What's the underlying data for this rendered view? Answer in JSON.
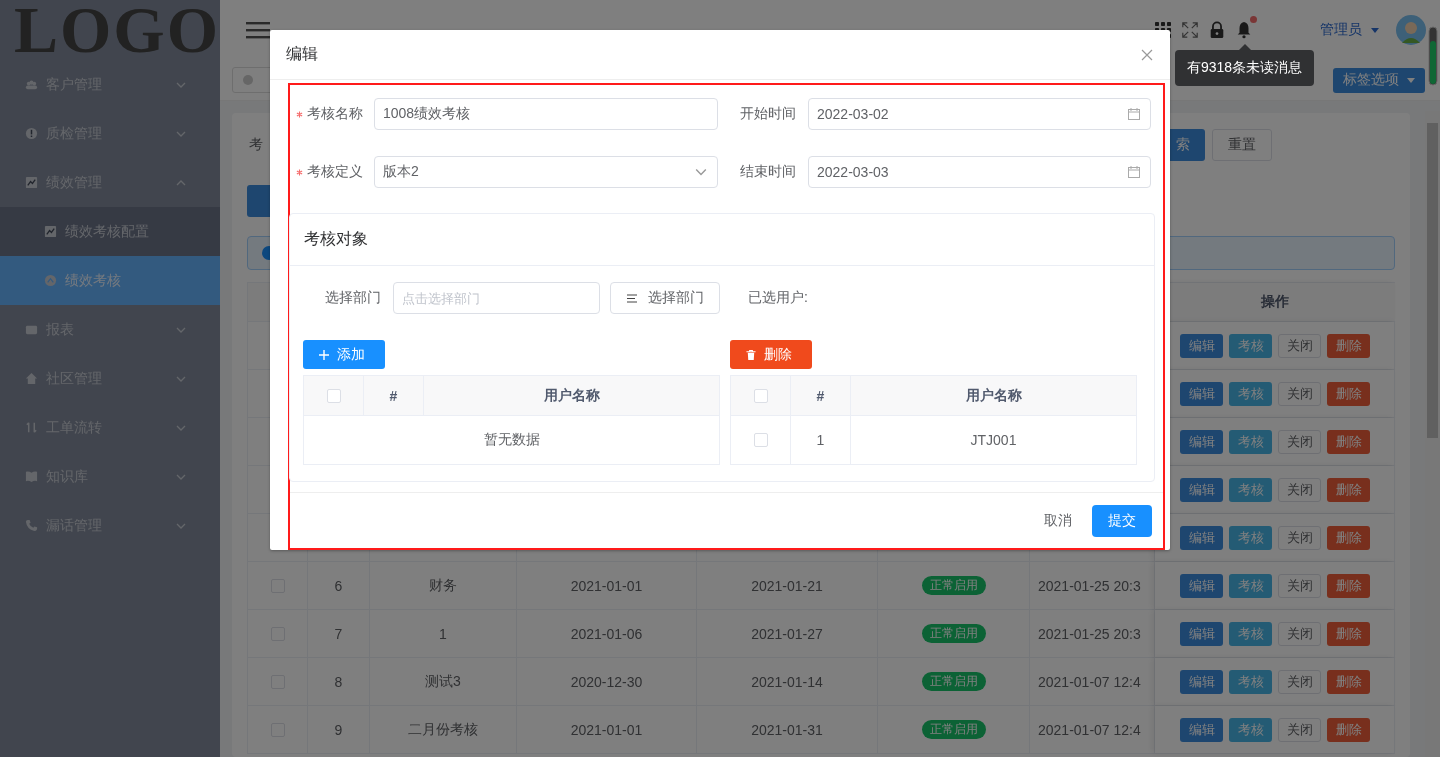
{
  "sidebar": {
    "logo": "LOGO",
    "items": [
      {
        "label": "客户管理",
        "selected": false,
        "expanded": false
      },
      {
        "label": "质检管理",
        "selected": false,
        "expanded": false
      },
      {
        "label": "绩效管理",
        "selected": false,
        "expanded": true,
        "children": [
          {
            "label": "绩效考核配置",
            "selected": false
          },
          {
            "label": "绩效考核",
            "selected": true
          }
        ]
      },
      {
        "label": "报表",
        "selected": false,
        "expanded": false
      },
      {
        "label": "社区管理",
        "selected": false,
        "expanded": false
      },
      {
        "label": "工单流转",
        "selected": false,
        "expanded": false
      },
      {
        "label": "知识库",
        "selected": false,
        "expanded": false
      },
      {
        "label": "漏话管理",
        "selected": false,
        "expanded": false
      }
    ]
  },
  "header": {
    "user": "管理员",
    "unread": true,
    "tooltip": "有9318条未读消息"
  },
  "tags_bar": {
    "options_button": "标签选项"
  },
  "search": {
    "label": "考",
    "search_button": "索",
    "reset_button": "重置"
  },
  "table": {
    "columns": [
      "操作"
    ],
    "rows": [
      {
        "actions": [
          {
            "label": "编辑",
            "kind": "primary"
          },
          {
            "label": "考核",
            "kind": "info"
          },
          {
            "label": "关闭",
            "kind": "plain"
          },
          {
            "label": "删除",
            "kind": "danger"
          }
        ]
      },
      {
        "actions": [
          {
            "label": "编辑",
            "kind": "primary"
          },
          {
            "label": "考核",
            "kind": "info"
          },
          {
            "label": "关闭",
            "kind": "plain"
          },
          {
            "label": "删除",
            "kind": "danger"
          }
        ]
      },
      {
        "actions": [
          {
            "label": "编辑",
            "kind": "primary"
          },
          {
            "label": "考核",
            "kind": "info"
          },
          {
            "label": "关闭",
            "kind": "plain"
          },
          {
            "label": "删除",
            "kind": "danger"
          }
        ]
      },
      {
        "actions": [
          {
            "label": "编辑",
            "kind": "primary"
          },
          {
            "label": "考核",
            "kind": "info"
          },
          {
            "label": "关闭",
            "kind": "plain"
          },
          {
            "label": "删除",
            "kind": "danger"
          }
        ]
      },
      {
        "actions": [
          {
            "label": "编辑",
            "kind": "primary"
          },
          {
            "label": "考核",
            "kind": "info"
          },
          {
            "label": "关闭",
            "kind": "plain"
          },
          {
            "label": "删除",
            "kind": "danger"
          }
        ]
      },
      {
        "checked": false,
        "index": "6",
        "name": "财务",
        "start": "2021-01-01",
        "end": "2021-01-21",
        "status": "正常启用",
        "created": "2021-01-25 20:3",
        "actions": [
          {
            "label": "编辑",
            "kind": "primary"
          },
          {
            "label": "考核",
            "kind": "info"
          },
          {
            "label": "关闭",
            "kind": "plain"
          },
          {
            "label": "删除",
            "kind": "danger"
          }
        ]
      },
      {
        "checked": false,
        "index": "7",
        "name": "1",
        "start": "2021-01-06",
        "end": "2021-01-27",
        "status": "正常启用",
        "created": "2021-01-25 20:3",
        "actions": [
          {
            "label": "编辑",
            "kind": "primary"
          },
          {
            "label": "考核",
            "kind": "info"
          },
          {
            "label": "关闭",
            "kind": "plain"
          },
          {
            "label": "删除",
            "kind": "danger"
          }
        ]
      },
      {
        "checked": false,
        "index": "8",
        "name": "测试3",
        "start": "2020-12-30",
        "end": "2021-01-14",
        "status": "正常启用",
        "created": "2021-01-07 12:4",
        "actions": [
          {
            "label": "编辑",
            "kind": "primary"
          },
          {
            "label": "考核",
            "kind": "info"
          },
          {
            "label": "关闭",
            "kind": "plain"
          },
          {
            "label": "删除",
            "kind": "danger"
          }
        ]
      },
      {
        "checked": false,
        "index": "9",
        "name": "二月份考核",
        "start": "2021-01-01",
        "end": "2021-01-31",
        "status": "正常启用",
        "created": "2021-01-07 12:4",
        "actions": [
          {
            "label": "编辑",
            "kind": "primary"
          },
          {
            "label": "考核",
            "kind": "info"
          },
          {
            "label": "关闭",
            "kind": "plain"
          },
          {
            "label": "删除",
            "kind": "danger"
          }
        ]
      }
    ]
  },
  "modal": {
    "title": "编辑",
    "fields": [
      {
        "label": "考核名称",
        "required": true,
        "value": "1008绩效考核",
        "kind": "text"
      },
      {
        "label": "开始时间",
        "required": false,
        "value": "2022-03-02",
        "kind": "date"
      },
      {
        "label": "考核定义",
        "required": true,
        "value": "版本2",
        "kind": "select"
      },
      {
        "label": "结束时间",
        "required": false,
        "value": "2022-03-03",
        "kind": "date"
      }
    ],
    "target": {
      "title": "考核对象",
      "dept_label": "选择部门",
      "dept_placeholder": "点击选择部门",
      "dept_button": "选择部门",
      "selected_label": "已选用户:",
      "left": {
        "button": "添加",
        "header_checked": false,
        "columns": [
          "#",
          "用户名称"
        ],
        "empty": "暂无数据"
      },
      "right": {
        "button": "删除",
        "header_checked": false,
        "columns": [
          "#",
          "用户名称"
        ],
        "rows": [
          {
            "checked": false,
            "index": "1",
            "name": "JTJ001"
          }
        ]
      }
    },
    "cancel": "取消",
    "submit": "提交"
  }
}
